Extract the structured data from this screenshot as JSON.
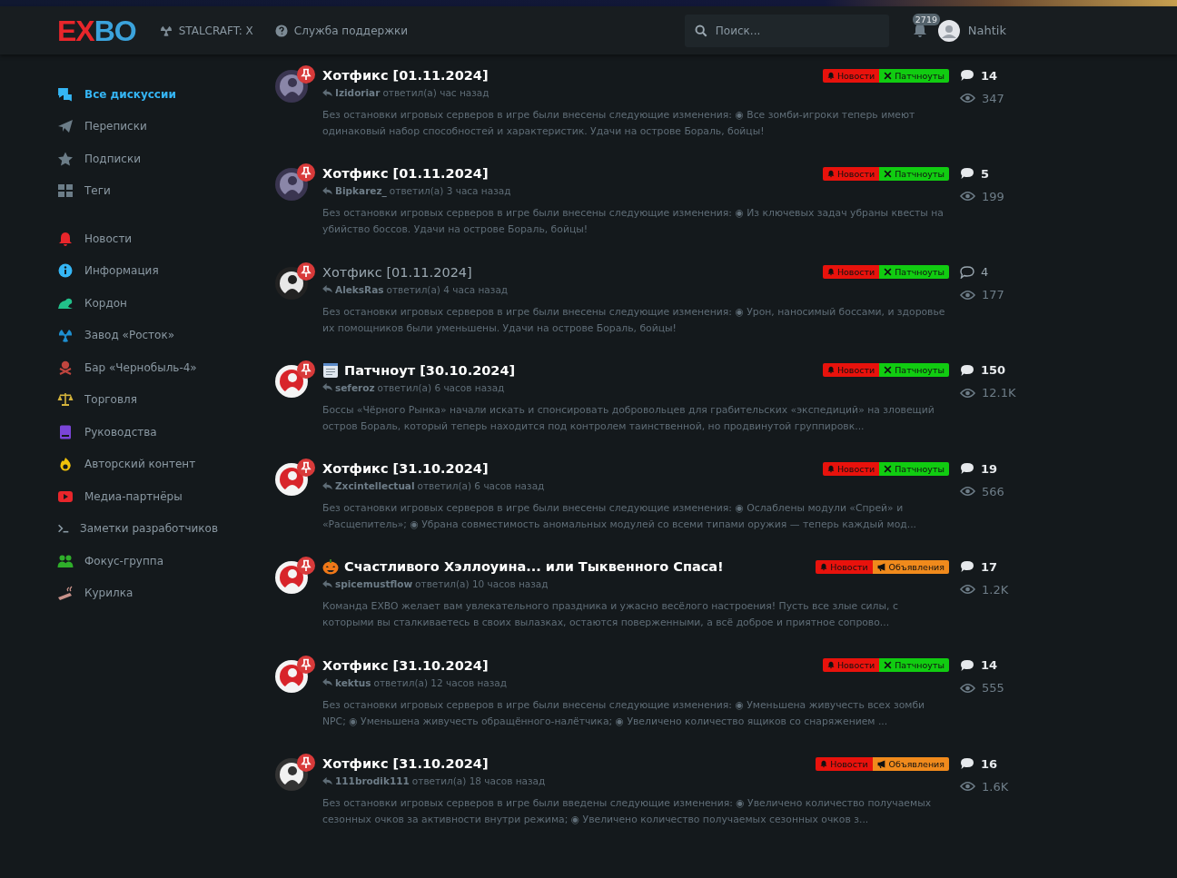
{
  "header": {
    "logo": [
      {
        "text": "E",
        "color": "#e8262b"
      },
      {
        "text": "X",
        "color": "#e8262b"
      },
      {
        "text": "BO",
        "color": "#3ba3dc"
      }
    ],
    "nav": [
      {
        "label": "STALCRAFT: X"
      },
      {
        "label": "Служба поддержки"
      }
    ],
    "search": {
      "placeholder": "Поиск..."
    },
    "notifications": {
      "count": "2719"
    },
    "user": {
      "name": "Nahtik"
    }
  },
  "sidebar": {
    "nav": [
      {
        "label": "Все дискуссии",
        "selected": true,
        "color": "#35b6f5"
      },
      {
        "label": "Переписки",
        "selected": false,
        "color": "#6c7d88"
      },
      {
        "label": "Подписки",
        "selected": false,
        "color": "#6c7d88"
      },
      {
        "label": "Теги",
        "selected": false,
        "color": "#6c7d88"
      }
    ],
    "tags": [
      {
        "label": "Новости",
        "selected": false,
        "color": "#e8262b"
      },
      {
        "label": "Информация",
        "selected": false,
        "color": "#35b6f5"
      },
      {
        "label": "Кордон",
        "selected": false,
        "color": "#22c08a"
      },
      {
        "label": "Завод «Росток»",
        "selected": false,
        "color": "#1e8fd0"
      },
      {
        "label": "Бар «Чернобыль-4»",
        "selected": false,
        "color": "#c0453e"
      },
      {
        "label": "Торговля",
        "selected": false,
        "color": "#d4b43c"
      },
      {
        "label": "Руководства",
        "selected": false,
        "color": "#7a45d8"
      },
      {
        "label": "Авторский контент",
        "selected": false,
        "color": "#f0c20a"
      },
      {
        "label": "Медиа-партнёры",
        "selected": false,
        "color": "#e8262b"
      },
      {
        "label": "Заметки разработчиков",
        "selected": false,
        "color": "#8a9aa4"
      },
      {
        "label": "Фокус-группа",
        "selected": false,
        "color": "#2fae2a"
      },
      {
        "label": "Курилка",
        "selected": false,
        "color": "#c8928a"
      }
    ]
  },
  "discussions": [
    {
      "title": "Хотфикс [01.11.2024]",
      "unread": true,
      "user": "Izidoriar",
      "action": "ответил(а) час назад",
      "excerpt": "Без остановки игровых серверов в игре были внесены следующие изменения: ◉ Все зомби-игроки теперь имеют одинаковый набор способностей и характеристик. Удачи на острове Бораль, бойцы!",
      "tags": [
        {
          "kind": "news",
          "label": "Новости",
          "color": "#e8120c"
        },
        {
          "kind": "patch",
          "label": "Патчноуты",
          "color": "#11cc11"
        }
      ],
      "replies": "14",
      "views": "347"
    },
    {
      "title": "Хотфикс [01.11.2024]",
      "unread": true,
      "user": "Bipkarez_",
      "action": "ответил(а) 3 часа назад",
      "excerpt": "Без остановки игровых серверов в игре были внесены следующие изменения: ◉ Из ключевых задач убраны квесты на убийство боссов. Удачи на острове Бораль, бойцы!",
      "tags": [
        {
          "kind": "news",
          "label": "Новости",
          "color": "#e8120c"
        },
        {
          "kind": "patch",
          "label": "Патчноуты",
          "color": "#11cc11"
        }
      ],
      "replies": "5",
      "views": "199"
    },
    {
      "title": "Хотфикс [01.11.2024]",
      "unread": false,
      "user": "AleksRas",
      "action": "ответил(а) 4 часа назад",
      "excerpt": "Без остановки игровых серверов в игре были внесены следующие изменения: ◉ Урон, наносимый боссами, и здоровье их помощников были уменьшены. Удачи на острове Бораль, бойцы!",
      "tags": [
        {
          "kind": "news",
          "label": "Новости",
          "color": "#e8120c"
        },
        {
          "kind": "patch",
          "label": "Патчноуты",
          "color": "#11cc11"
        }
      ],
      "replies": "4",
      "views": "177"
    },
    {
      "title": "Патчноут [30.10.2024]",
      "unread": true,
      "user": "seferoz",
      "action": "ответил(а) 6 часов назад",
      "excerpt": "Боссы «Чёрного Рынка» начали искать и спонсировать добровольцев для грабительских «экспедиций» на зловещий остров Бораль, который теперь находится под контролем таинственной, но продвинутой группировк...",
      "tags": [
        {
          "kind": "news",
          "label": "Новости",
          "color": "#e8120c"
        },
        {
          "kind": "patch",
          "label": "Патчноуты",
          "color": "#11cc11"
        }
      ],
      "replies": "150",
      "views": "12.1K"
    },
    {
      "title": "Хотфикс [31.10.2024]",
      "unread": true,
      "user": "Zxcintellectual",
      "action": "ответил(а) 6 часов назад",
      "excerpt": "Без остановки игровых серверов в игре были внесены следующие изменения: ◉ Ослаблены модули «Спрей» и «Расщепитель»; ◉ Убрана совместимость аномальных модулей со всеми типами оружия — теперь каждый мод...",
      "tags": [
        {
          "kind": "news",
          "label": "Новости",
          "color": "#e8120c"
        },
        {
          "kind": "patch",
          "label": "Патчноуты",
          "color": "#11cc11"
        }
      ],
      "replies": "19",
      "views": "566"
    },
    {
      "title": "Счастливого Хэллоуина... или Тыквенного Спаса!",
      "unread": true,
      "user": "spicemustflow",
      "action": "ответил(а) 10 часов назад",
      "excerpt": "Команда EXBO желает вам увлекательного праздника и ужасно весёлого настроения! Пусть все злые силы, с которыми вы сталкиваетесь в своих вылазках, остаются поверженными, а всё доброе и приятное сопрово...",
      "tags": [
        {
          "kind": "news",
          "label": "Новости",
          "color": "#e8120c"
        },
        {
          "kind": "announce",
          "label": "Объявления",
          "color": "#f08a1c"
        }
      ],
      "replies": "17",
      "views": "1.2K"
    },
    {
      "title": "Хотфикс [31.10.2024]",
      "unread": true,
      "user": "kektus",
      "action": "ответил(а) 12 часов назад",
      "excerpt": "Без остановки игровых серверов в игре были внесены следующие изменения: ◉ Уменьшена живучесть всех зомби NPC; ◉ Уменьшена живучесть обращённого-налётчика; ◉ Увеличено количество ящиков со снаряжением ...",
      "tags": [
        {
          "kind": "news",
          "label": "Новости",
          "color": "#e8120c"
        },
        {
          "kind": "patch",
          "label": "Патчноуты",
          "color": "#11cc11"
        }
      ],
      "replies": "14",
      "views": "555"
    },
    {
      "title": "Хотфикс [31.10.2024]",
      "unread": true,
      "user": "111brodik111",
      "action": "ответил(а) 18 часов назад",
      "excerpt": "Без остановки игровых серверов в игре были введены следующие изменения: ◉ Увеличено количество получаемых сезонных очков за активности внутри режима; ◉ Увеличено количество получаемых сезонных очков з...",
      "tags": [
        {
          "kind": "news",
          "label": "Новости",
          "color": "#e8120c"
        },
        {
          "kind": "announce",
          "label": "Объявления",
          "color": "#f08a1c"
        }
      ],
      "replies": "16",
      "views": "1.6K"
    }
  ]
}
